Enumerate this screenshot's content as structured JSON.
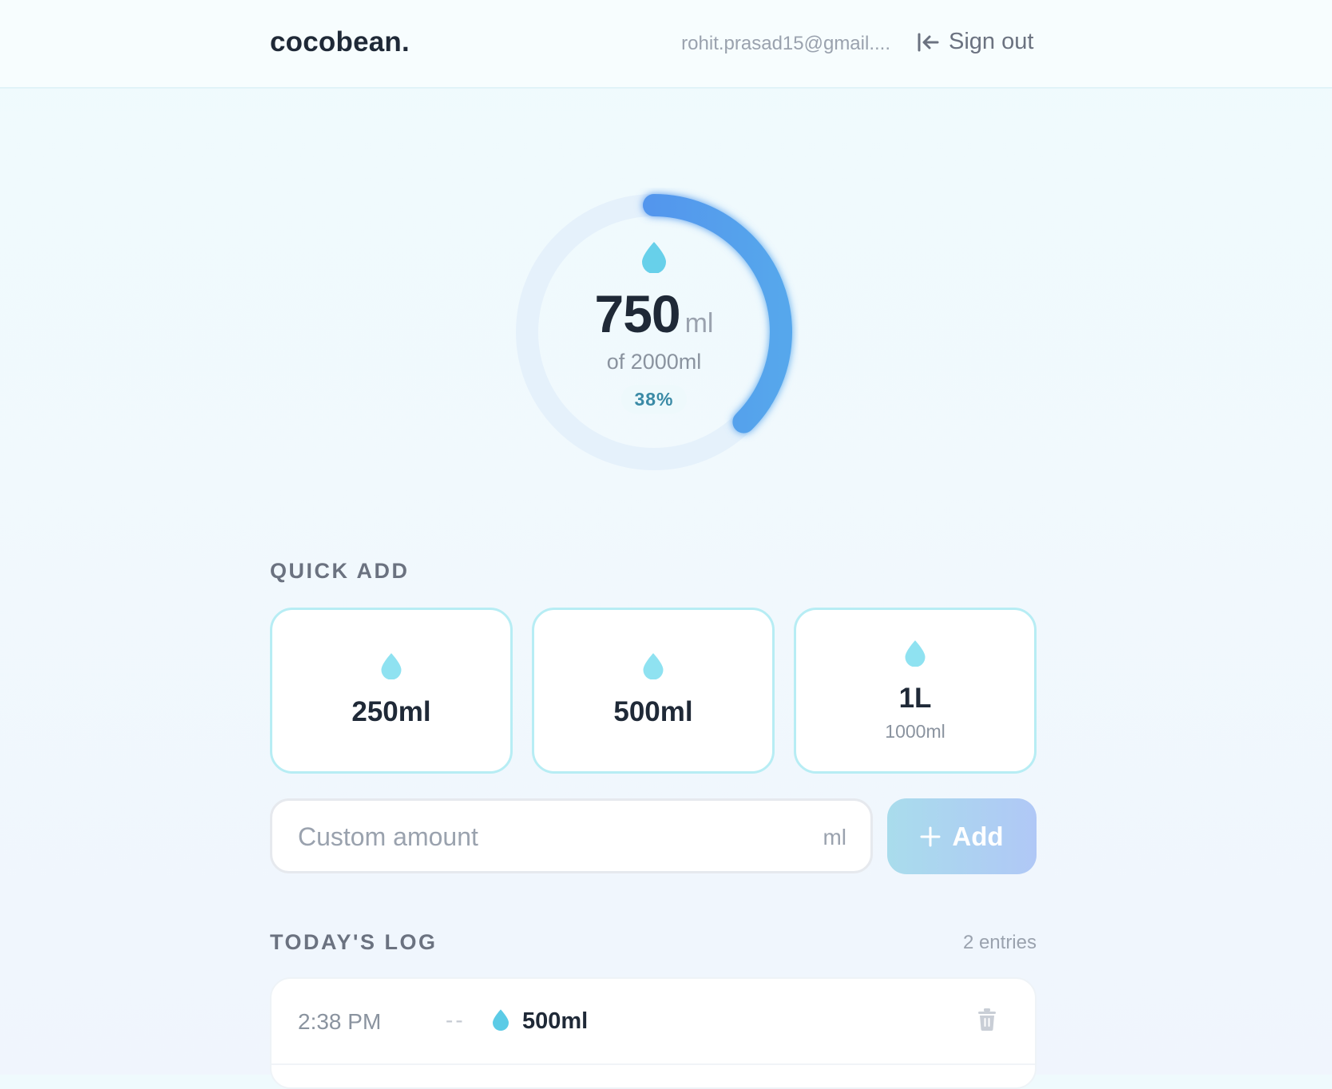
{
  "app": {
    "brand": "cocobean.",
    "user_email": "rohit.prasad15@gmail....",
    "sign_out_label": "Sign out"
  },
  "progress": {
    "current_value": "750",
    "current_unit": "ml",
    "goal_text": "of 2000ml",
    "percent_text": "38%",
    "fraction": 0.375,
    "colors": {
      "track": "#e5f1fb",
      "start": "#4f86ee",
      "end": "#56a7ec",
      "drop": "#67d0ea"
    }
  },
  "quick_add": {
    "title": "QUICK ADD",
    "items": [
      {
        "label": "250ml",
        "sublabel": "",
        "icon": "water-drop-icon"
      },
      {
        "label": "500ml",
        "sublabel": "",
        "icon": "water-drop-icon"
      },
      {
        "label": "1L",
        "sublabel": "1000ml",
        "icon": "water-drop-icon"
      }
    ]
  },
  "custom": {
    "placeholder": "Custom amount",
    "value": "",
    "unit": "ml",
    "add_label": "Add",
    "add_icon": "plus-icon"
  },
  "log": {
    "title": "TODAY'S LOG",
    "count_text": "2 entries",
    "entries": [
      {
        "time": "2:38 PM",
        "separator": "--",
        "amount": "500ml",
        "icon": "water-drop-icon",
        "action_icon": "trash-icon"
      }
    ]
  }
}
